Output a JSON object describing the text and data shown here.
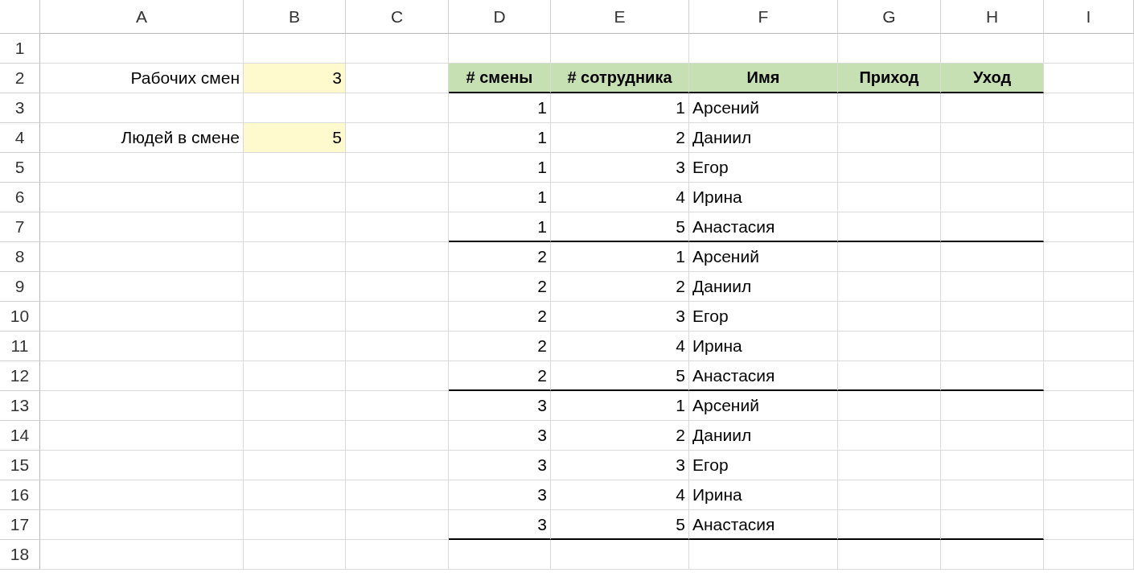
{
  "columns": [
    {
      "letter": "A"
    },
    {
      "letter": "B"
    },
    {
      "letter": "C"
    },
    {
      "letter": "D"
    },
    {
      "letter": "E"
    },
    {
      "letter": "F"
    },
    {
      "letter": "G"
    },
    {
      "letter": "H"
    },
    {
      "letter": "I"
    }
  ],
  "rows": [
    {
      "number": "1",
      "rule_below": false,
      "cells": [
        null,
        null,
        null,
        null,
        null,
        null,
        null,
        null,
        null
      ]
    },
    {
      "number": "2",
      "rule_below": true,
      "cells": [
        {
          "kind": "label",
          "text": "Рабочих смен"
        },
        {
          "kind": "input",
          "text": "3"
        },
        null,
        {
          "kind": "header",
          "text": "# смены"
        },
        {
          "kind": "header",
          "text": "# сотрудника"
        },
        {
          "kind": "header",
          "text": "Имя"
        },
        {
          "kind": "header",
          "text": "Приход"
        },
        {
          "kind": "header",
          "text": "Уход"
        },
        null
      ]
    },
    {
      "number": "3",
      "rule_below": false,
      "cells": [
        null,
        null,
        null,
        {
          "kind": "number",
          "text": "1"
        },
        {
          "kind": "number",
          "text": "1"
        },
        {
          "kind": "text",
          "text": "Арсений"
        },
        null,
        null,
        null
      ]
    },
    {
      "number": "4",
      "rule_below": false,
      "cells": [
        {
          "kind": "label",
          "text": "Людей в смене"
        },
        {
          "kind": "input",
          "text": "5"
        },
        null,
        {
          "kind": "number",
          "text": "1"
        },
        {
          "kind": "number",
          "text": "2"
        },
        {
          "kind": "text",
          "text": "Даниил"
        },
        null,
        null,
        null
      ]
    },
    {
      "number": "5",
      "rule_below": false,
      "cells": [
        null,
        null,
        null,
        {
          "kind": "number",
          "text": "1"
        },
        {
          "kind": "number",
          "text": "3"
        },
        {
          "kind": "text",
          "text": "Егор"
        },
        null,
        null,
        null
      ]
    },
    {
      "number": "6",
      "rule_below": false,
      "cells": [
        null,
        null,
        null,
        {
          "kind": "number",
          "text": "1"
        },
        {
          "kind": "number",
          "text": "4"
        },
        {
          "kind": "text",
          "text": "Ирина"
        },
        null,
        null,
        null
      ]
    },
    {
      "number": "7",
      "rule_below": true,
      "cells": [
        null,
        null,
        null,
        {
          "kind": "number",
          "text": "1"
        },
        {
          "kind": "number",
          "text": "5"
        },
        {
          "kind": "text",
          "text": "Анастасия"
        },
        null,
        null,
        null
      ]
    },
    {
      "number": "8",
      "rule_below": false,
      "cells": [
        null,
        null,
        null,
        {
          "kind": "number",
          "text": "2"
        },
        {
          "kind": "number",
          "text": "1"
        },
        {
          "kind": "text",
          "text": "Арсений"
        },
        null,
        null,
        null
      ]
    },
    {
      "number": "9",
      "rule_below": false,
      "cells": [
        null,
        null,
        null,
        {
          "kind": "number",
          "text": "2"
        },
        {
          "kind": "number",
          "text": "2"
        },
        {
          "kind": "text",
          "text": "Даниил"
        },
        null,
        null,
        null
      ]
    },
    {
      "number": "10",
      "rule_below": false,
      "cells": [
        null,
        null,
        null,
        {
          "kind": "number",
          "text": "2"
        },
        {
          "kind": "number",
          "text": "3"
        },
        {
          "kind": "text",
          "text": "Егор"
        },
        null,
        null,
        null
      ]
    },
    {
      "number": "11",
      "rule_below": false,
      "cells": [
        null,
        null,
        null,
        {
          "kind": "number",
          "text": "2"
        },
        {
          "kind": "number",
          "text": "4"
        },
        {
          "kind": "text",
          "text": "Ирина"
        },
        null,
        null,
        null
      ]
    },
    {
      "number": "12",
      "rule_below": true,
      "cells": [
        null,
        null,
        null,
        {
          "kind": "number",
          "text": "2"
        },
        {
          "kind": "number",
          "text": "5"
        },
        {
          "kind": "text",
          "text": "Анастасия"
        },
        null,
        null,
        null
      ]
    },
    {
      "number": "13",
      "rule_below": false,
      "cells": [
        null,
        null,
        null,
        {
          "kind": "number",
          "text": "3"
        },
        {
          "kind": "number",
          "text": "1"
        },
        {
          "kind": "text",
          "text": "Арсений"
        },
        null,
        null,
        null
      ]
    },
    {
      "number": "14",
      "rule_below": false,
      "cells": [
        null,
        null,
        null,
        {
          "kind": "number",
          "text": "3"
        },
        {
          "kind": "number",
          "text": "2"
        },
        {
          "kind": "text",
          "text": "Даниил"
        },
        null,
        null,
        null
      ]
    },
    {
      "number": "15",
      "rule_below": false,
      "cells": [
        null,
        null,
        null,
        {
          "kind": "number",
          "text": "3"
        },
        {
          "kind": "number",
          "text": "3"
        },
        {
          "kind": "text",
          "text": "Егор"
        },
        null,
        null,
        null
      ]
    },
    {
      "number": "16",
      "rule_below": false,
      "cells": [
        null,
        null,
        null,
        {
          "kind": "number",
          "text": "3"
        },
        {
          "kind": "number",
          "text": "4"
        },
        {
          "kind": "text",
          "text": "Ирина"
        },
        null,
        null,
        null
      ]
    },
    {
      "number": "17",
      "rule_below": true,
      "cells": [
        null,
        null,
        null,
        {
          "kind": "number",
          "text": "3"
        },
        {
          "kind": "number",
          "text": "5"
        },
        {
          "kind": "text",
          "text": "Анастасия"
        },
        null,
        null,
        null
      ]
    },
    {
      "number": "18",
      "rule_below": false,
      "cells": [
        null,
        null,
        null,
        null,
        null,
        null,
        null,
        null,
        null
      ]
    }
  ]
}
